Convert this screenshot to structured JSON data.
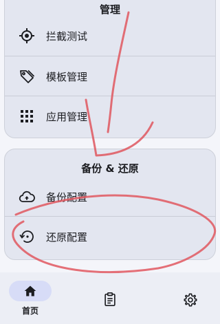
{
  "top_section": {
    "title": "管理",
    "items": [
      {
        "label": "拦截测试",
        "icon": "crosshair-icon"
      },
      {
        "label": "模板管理",
        "icon": "tag-icon"
      },
      {
        "label": "应用管理",
        "icon": "apps-grid-icon"
      }
    ]
  },
  "backup_section": {
    "title": "备份 & 还原",
    "items": [
      {
        "label": "备份配置",
        "icon": "cloud-upload-icon"
      },
      {
        "label": "还原配置",
        "icon": "restore-icon"
      }
    ]
  },
  "bottom_nav": {
    "items": [
      {
        "label": "首页",
        "icon": "home-icon",
        "selected": true
      },
      {
        "label": "",
        "icon": "clipboard-icon",
        "selected": false
      },
      {
        "label": "",
        "icon": "gear-icon",
        "selected": false
      }
    ]
  },
  "colors": {
    "background": "#f4f5fa",
    "card": "#e3e6f0",
    "nav_indicator": "#d7dcf7",
    "annotation_stroke": "#e0575f"
  }
}
